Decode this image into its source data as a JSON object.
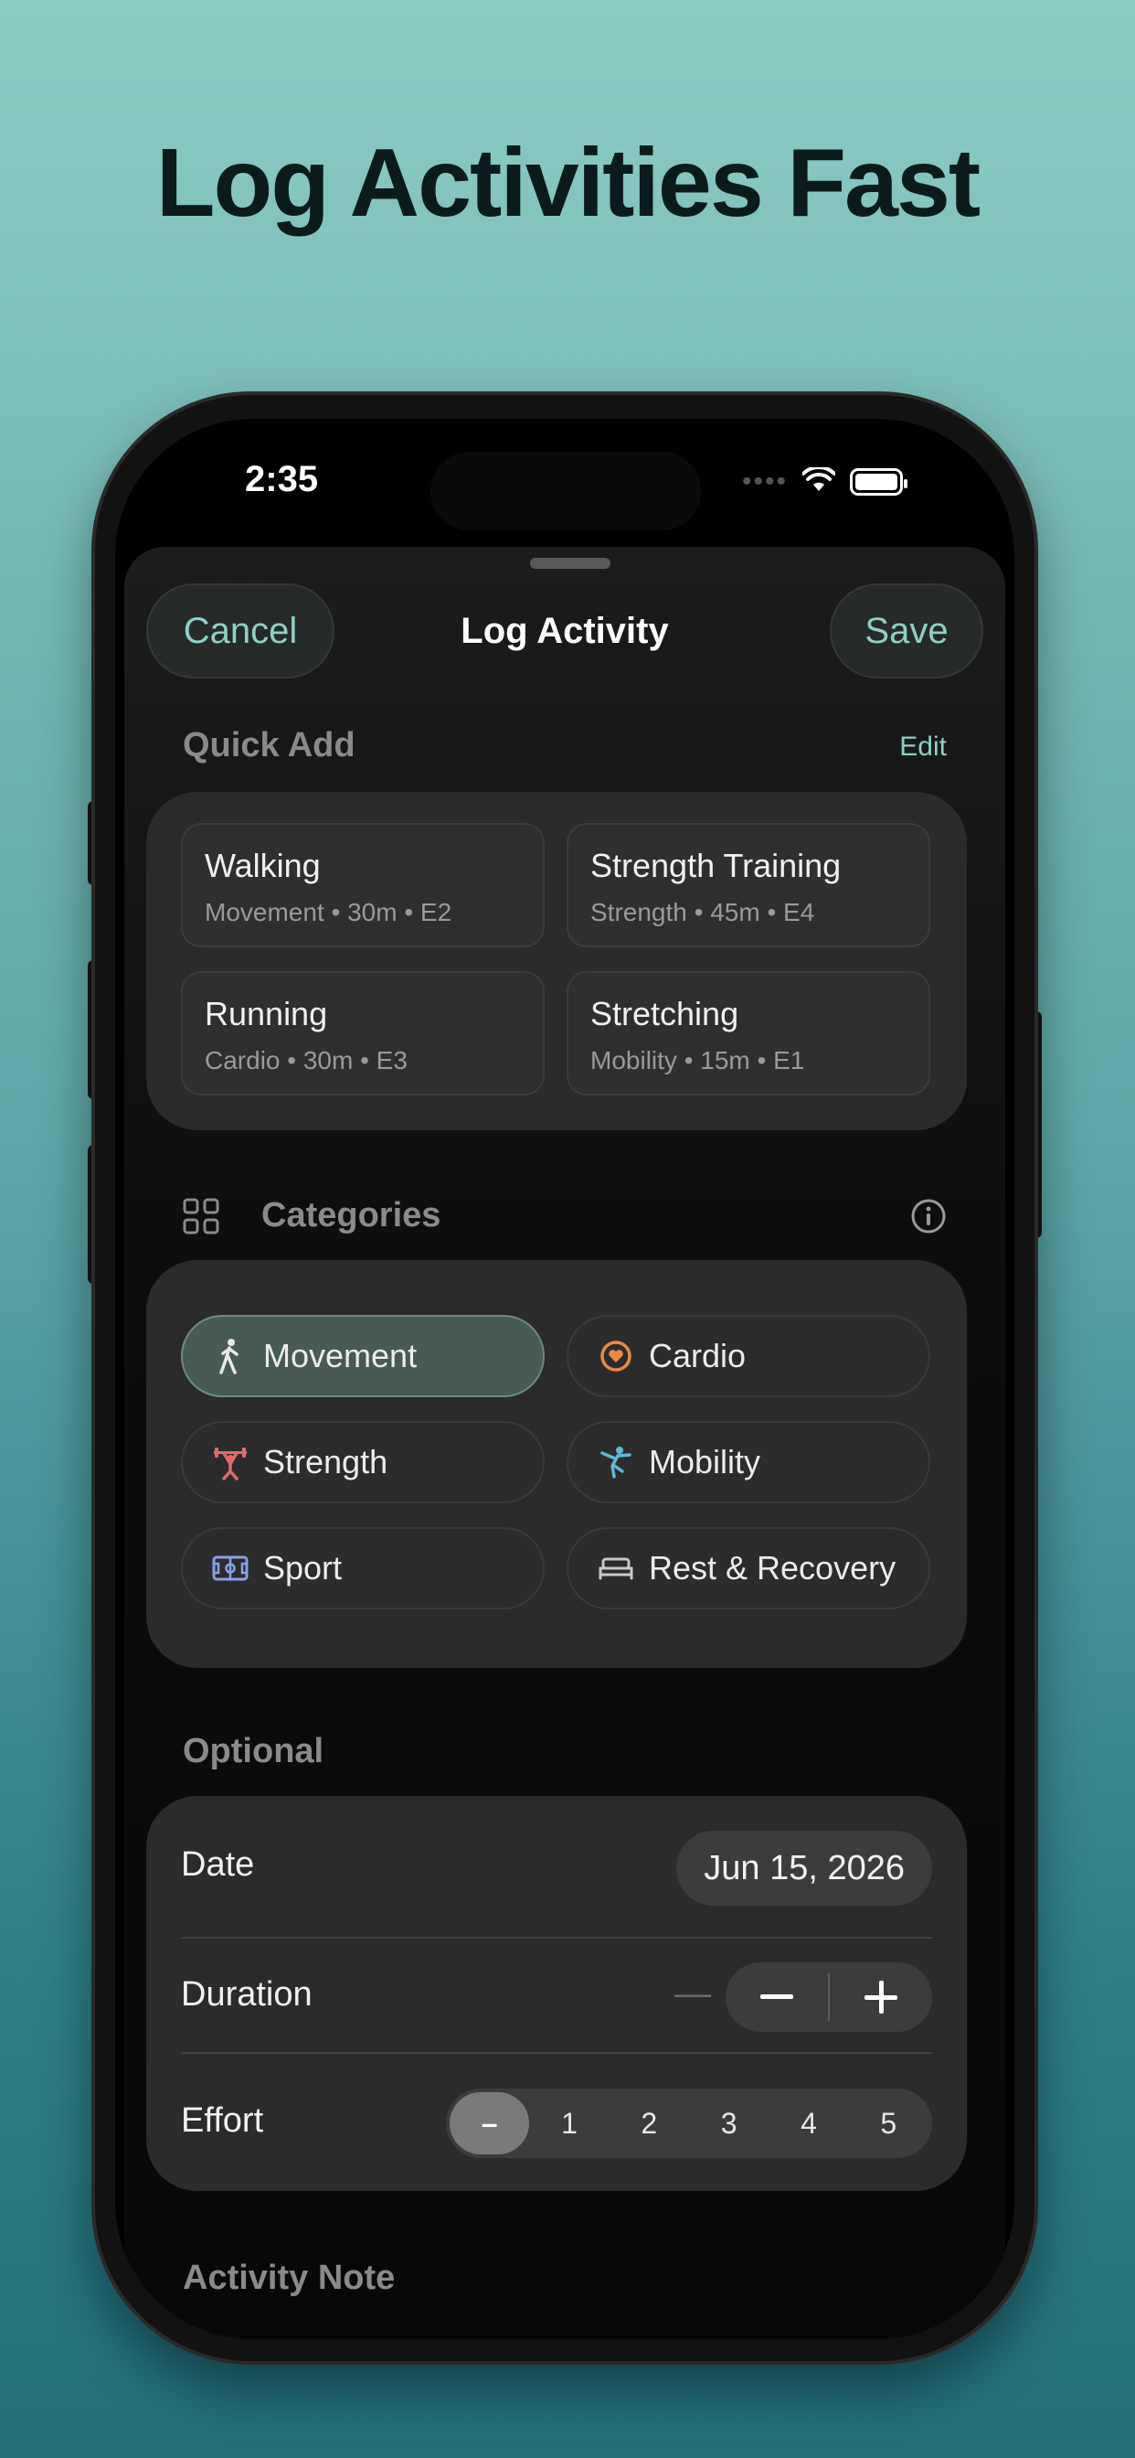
{
  "headline": "Log Activities Fast",
  "status": {
    "time": "2:35"
  },
  "nav": {
    "cancel": "Cancel",
    "title": "Log Activity",
    "save": "Save"
  },
  "quick_add": {
    "label": "Quick Add",
    "edit": "Edit",
    "items": [
      {
        "title": "Walking",
        "sub": "Movement • 30m • E2"
      },
      {
        "title": "Strength Training",
        "sub": "Strength • 45m • E4"
      },
      {
        "title": "Running",
        "sub": "Cardio • 30m • E3"
      },
      {
        "title": "Stretching",
        "sub": "Mobility • 15m • E1"
      }
    ]
  },
  "categories": {
    "label": "Categories",
    "items": [
      {
        "label": "Movement",
        "icon": "walking-icon",
        "selected": true
      },
      {
        "label": "Cardio",
        "icon": "heart-icon",
        "color": "#e8894a"
      },
      {
        "label": "Strength",
        "icon": "weightlifter-icon",
        "color": "#e06a6a"
      },
      {
        "label": "Mobility",
        "icon": "stretch-icon",
        "color": "#5fb8d6"
      },
      {
        "label": "Sport",
        "icon": "field-icon",
        "color": "#8aa0ea"
      },
      {
        "label": "Rest & Recovery",
        "icon": "bed-icon"
      }
    ]
  },
  "optional": {
    "label": "Optional",
    "date_label": "Date",
    "date_value": "Jun 15, 2026",
    "duration_label": "Duration",
    "duration_value": "—",
    "effort_label": "Effort",
    "effort_options": [
      "–",
      "1",
      "2",
      "3",
      "4",
      "5"
    ]
  },
  "activity_note": {
    "label": "Activity Note"
  },
  "colors": {
    "accent": "#8fd0c6",
    "selected_chip": "#475a56"
  }
}
